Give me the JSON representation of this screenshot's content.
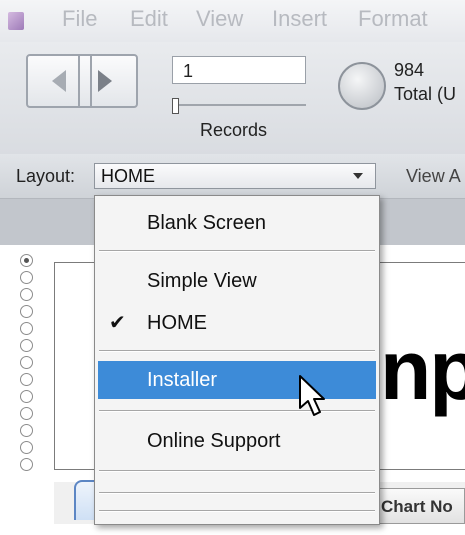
{
  "menubar": {
    "items": [
      "File",
      "Edit",
      "View",
      "Insert",
      "Format"
    ]
  },
  "toolbar": {
    "record_value": "1",
    "records_label": "Records",
    "total_count": "984",
    "total_label": "Total (U"
  },
  "layoutbar": {
    "layout_label": "Layout:",
    "selected_layout": "HOME",
    "view_label": "View A"
  },
  "dropdown": {
    "items": [
      {
        "label": "Blank Screen",
        "checked": false,
        "highlighted": false
      },
      {
        "label": "Simple View",
        "checked": false,
        "highlighted": false
      },
      {
        "label": "HOME",
        "checked": true,
        "highlighted": false
      },
      {
        "label": "Installer",
        "checked": false,
        "highlighted": true
      },
      {
        "label": "Online Support",
        "checked": false,
        "highlighted": false
      }
    ],
    "check_glyph": "✔"
  },
  "content": {
    "big_text": "np",
    "tab_chart_label": "Chart No"
  },
  "colors": {
    "highlight": "#3d8bd8",
    "tab_border": "#5c86c4"
  }
}
